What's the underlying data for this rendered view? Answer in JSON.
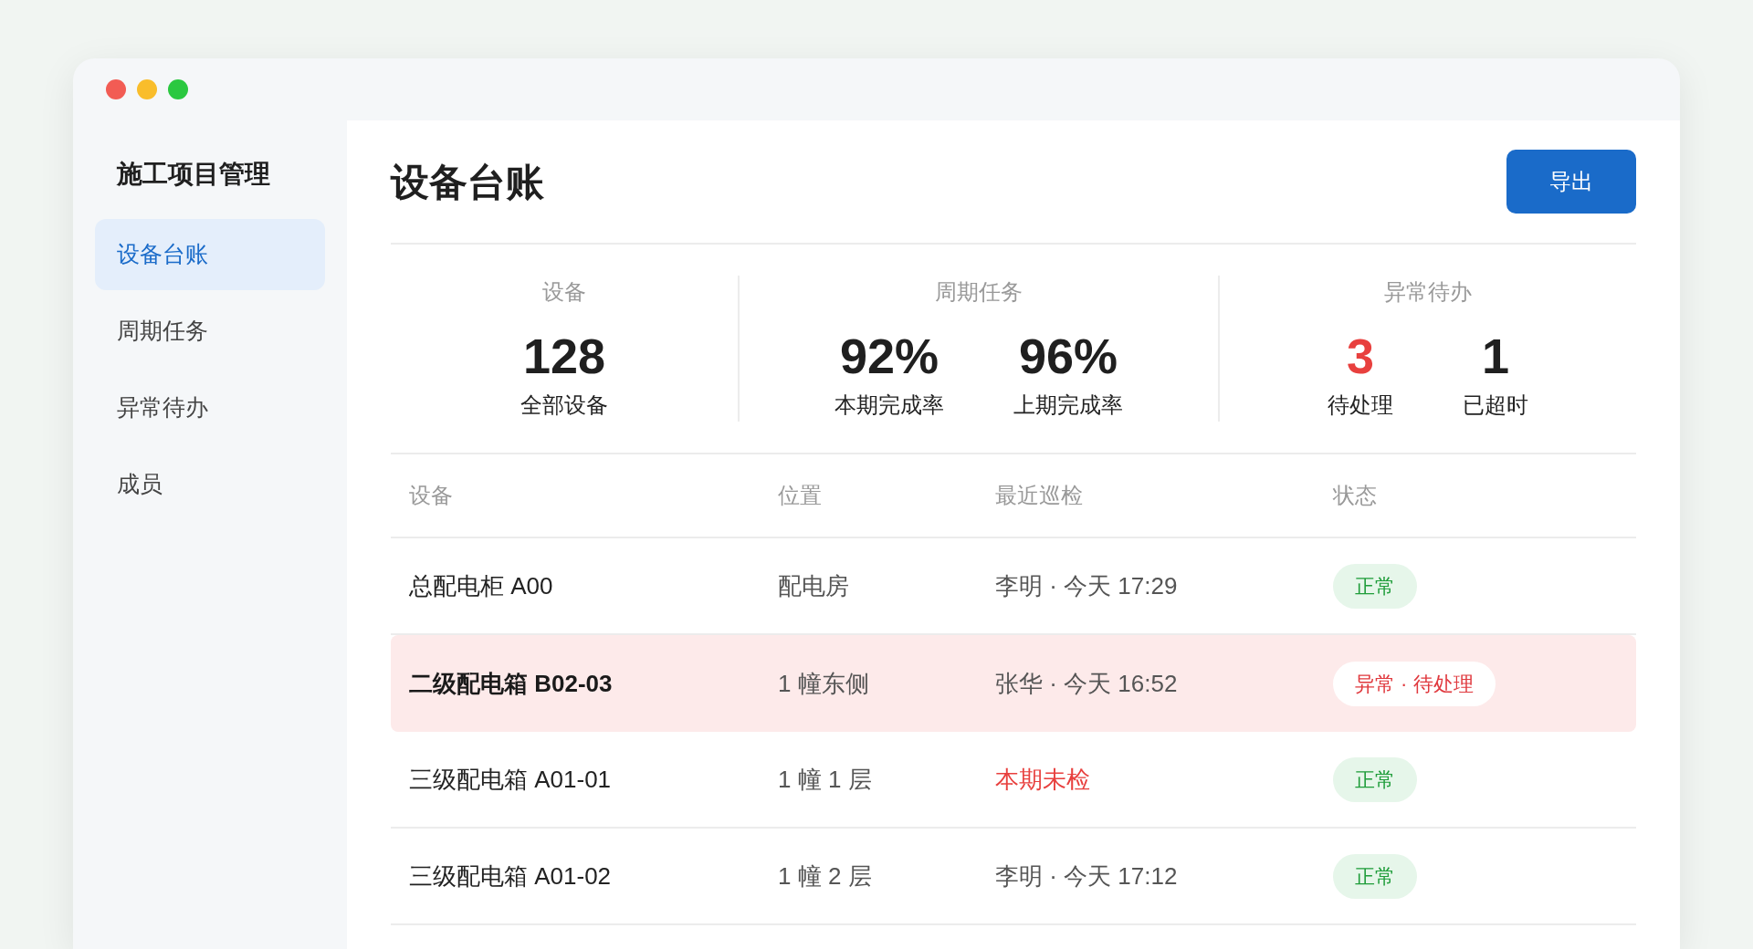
{
  "sidebar": {
    "title": "施工项目管理",
    "items": [
      {
        "label": "设备台账",
        "selected": true
      },
      {
        "label": "周期任务",
        "selected": false
      },
      {
        "label": "异常待办",
        "selected": false
      },
      {
        "label": "成员",
        "selected": false
      }
    ]
  },
  "page": {
    "title": "设备台账",
    "export_button": "导出"
  },
  "stats": [
    {
      "title": "设备",
      "metrics": [
        {
          "value": "128",
          "label": "全部设备",
          "alert": false
        }
      ]
    },
    {
      "title": "周期任务",
      "metrics": [
        {
          "value": "92%",
          "label": "本期完成率",
          "alert": false
        },
        {
          "value": "96%",
          "label": "上期完成率",
          "alert": false
        }
      ]
    },
    {
      "title": "异常待办",
      "metrics": [
        {
          "value": "3",
          "label": "待处理",
          "alert": true
        },
        {
          "value": "1",
          "label": "已超时",
          "alert": false
        }
      ]
    }
  ],
  "table": {
    "columns": [
      "设备",
      "位置",
      "最近巡检",
      "状态"
    ],
    "rows": [
      {
        "device": "总配电柜 A00",
        "location": "配电房",
        "last_check": "李明 · 今天 17:29",
        "last_check_alert": false,
        "status": {
          "label": "正常",
          "kind": "normal"
        },
        "highlighted": false
      },
      {
        "device": "二级配电箱 B02-03",
        "location": "1 幢东侧",
        "last_check": "张华 · 今天 16:52",
        "last_check_alert": false,
        "status": {
          "label": "异常 · 待处理",
          "kind": "alert"
        },
        "highlighted": true
      },
      {
        "device": "三级配电箱 A01-01",
        "location": "1 幢 1 层",
        "last_check": "本期未检",
        "last_check_alert": true,
        "status": {
          "label": "正常",
          "kind": "normal"
        },
        "highlighted": false
      },
      {
        "device": "三级配电箱 A01-02",
        "location": "1 幢 2 层",
        "last_check": "李明 · 今天 17:12",
        "last_check_alert": false,
        "status": {
          "label": "正常",
          "kind": "normal"
        },
        "highlighted": false
      }
    ]
  }
}
